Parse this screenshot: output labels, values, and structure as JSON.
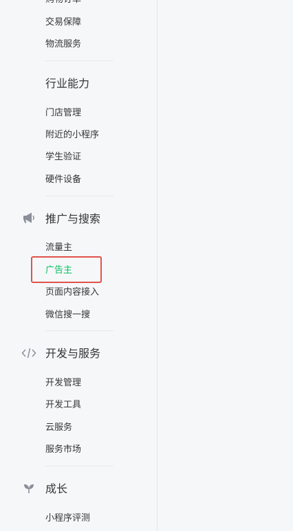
{
  "sidebar": {
    "cut_item": "购物订单",
    "group0": {
      "items": [
        "交易保障",
        "物流服务"
      ]
    },
    "industry": {
      "title": "行业能力",
      "items": [
        "门店管理",
        "附近的小程序",
        "学生验证",
        "硬件设备"
      ]
    },
    "promotion": {
      "title": "推广与搜索",
      "icon": "megaphone-icon",
      "items": [
        "流量主",
        "广告主",
        "页面内容接入",
        "微信搜一搜"
      ],
      "active_item": "广告主"
    },
    "develop": {
      "title": "开发与服务",
      "icon": "code-icon",
      "items": [
        "开发管理",
        "开发工具",
        "云服务",
        "服务市场"
      ]
    },
    "growth": {
      "title": "成长",
      "icon": "sprout-icon",
      "items": [
        "小程序评测"
      ]
    }
  },
  "colors": {
    "active": "#07c160",
    "highlight_border": "#e0524a",
    "text": "#353535",
    "icon": "#8a8f99"
  }
}
